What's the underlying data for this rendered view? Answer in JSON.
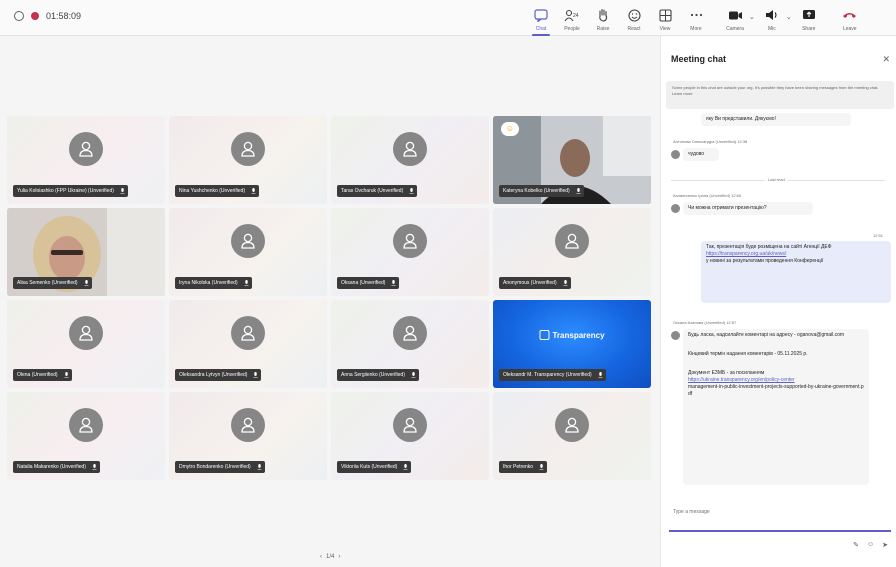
{
  "topbar": {
    "timer": "01:58:09",
    "tools": [
      {
        "name": "chat",
        "label": "Chat",
        "active": true
      },
      {
        "name": "people",
        "label": "People",
        "count": "24"
      },
      {
        "name": "raise",
        "label": "Raise"
      },
      {
        "name": "react",
        "label": "React"
      },
      {
        "name": "view",
        "label": "View"
      },
      {
        "name": "more",
        "label": "More"
      },
      {
        "name": "camera",
        "label": "Camera"
      },
      {
        "name": "mic",
        "label": "Mic"
      },
      {
        "name": "share",
        "label": "Share"
      },
      {
        "name": "leave",
        "label": "Leave"
      }
    ]
  },
  "tiles": [
    {
      "name": "Yulia Koloiashko (FPP Ukraine) (Unverified)",
      "kind": "avatar"
    },
    {
      "name": "Nina Yushchenko (Unverified)",
      "kind": "avatar"
    },
    {
      "name": "Taras Ovcharuk (Unverified)",
      "kind": "avatar"
    },
    {
      "name": "Kateryna Kobelko (Unverified)",
      "kind": "video-face",
      "reaction": "☺"
    },
    {
      "name": "Alisa Semenko (Unverified)",
      "kind": "video-blonde"
    },
    {
      "name": "Iryna Nikolska (Unverified)",
      "kind": "avatar"
    },
    {
      "name": "Oksana (Unverified)",
      "kind": "avatar"
    },
    {
      "name": "Anonymous (Unverified)",
      "kind": "avatar"
    },
    {
      "name": "Olena (Unverified)",
      "kind": "avatar"
    },
    {
      "name": "Oleksandra Lytvyn (Unverified)",
      "kind": "avatar"
    },
    {
      "name": "Anna Sergiienko (Unverified)",
      "kind": "avatar"
    },
    {
      "name": "Oleksandr M. Transparency (Unverified)",
      "kind": "share",
      "logo": "Transparency"
    },
    {
      "name": "Natalia Makarenko (Unverified)",
      "kind": "avatar"
    },
    {
      "name": "Dmytro Bondarenko (Unverified)",
      "kind": "avatar"
    },
    {
      "name": "Viktoriia Kuts (Unverified)",
      "kind": "avatar"
    },
    {
      "name": "Ihor Petrenko",
      "kind": "avatar"
    }
  ],
  "pager": {
    "label": "1/4"
  },
  "chat": {
    "title": "Meeting chat",
    "banner": "Some people in this chat are outside your org. It's possible they have been sharing messages from the meeting chat. Learn more",
    "messages": {
      "m1_text": "яку Ви представили. Дякуємо!",
      "m2_meta": "Антонова Олександра (Unverified)   12:38",
      "m2_text": "чудово",
      "divider": "Last read",
      "m3_meta": "Калиниченко Ірина (Unverified)   12:50",
      "m3_text": "Чи можна отримати презентацію?",
      "m4_meta": "12:51",
      "m4_text": "Так, презентація буде розміщена на сайті Агенції ДЕФ",
      "m4_link": "https://transparency.org.ua/uk/news/",
      "m4_tail": "у новині за результатами проведення Конференції",
      "m5_meta": "Оксана Аханова (Unverified)   12:57",
      "m5_text": "Будь ласка, надсилайте коментарі на адресу - oganova@gmail.com",
      "m5_deadline": "Кінцевий термін надання коментарів - 05.11.2025 р.",
      "m5_doc": "Документ ЕЗМБ - за посиланням",
      "m5_link": "https://ukraine.transparency.org/en/policy-center",
      "m5_tail": "management-in-public-investment-projects-supported-by-ukraine-government.pdf"
    },
    "compose_placeholder": "Type a message"
  }
}
